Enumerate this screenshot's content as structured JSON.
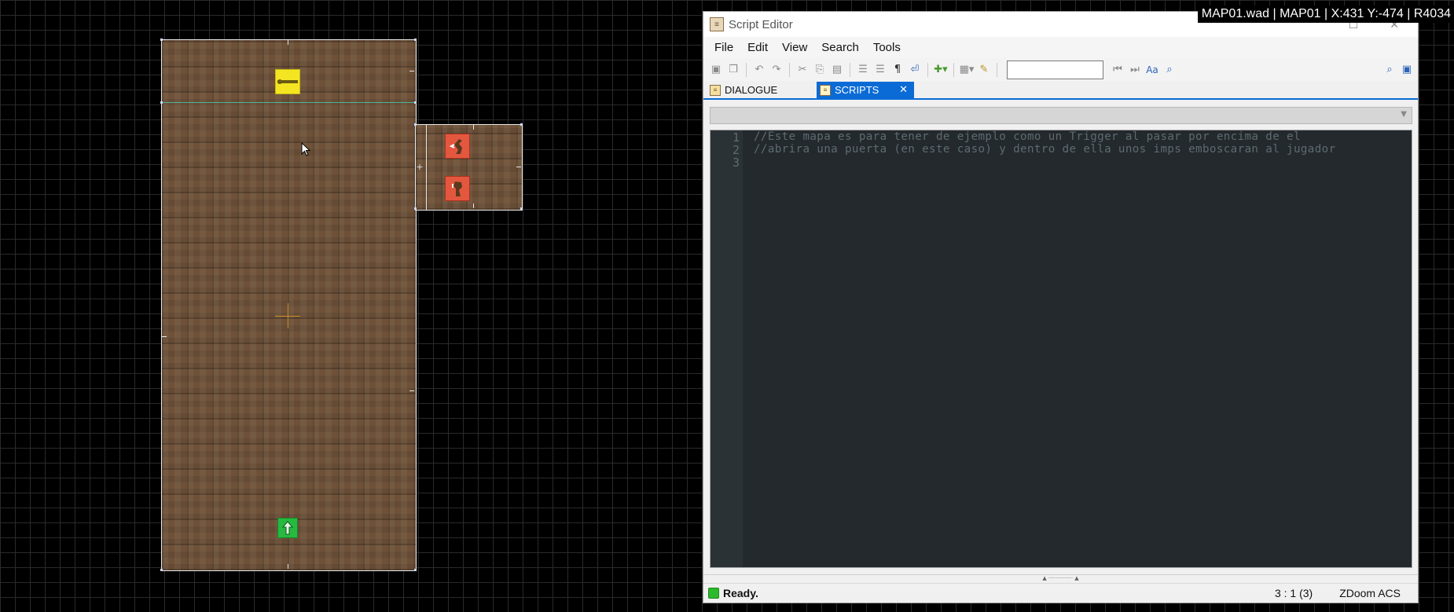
{
  "map_status": "MAP01.wad | MAP01 | X:431 Y:-474 | R4034",
  "editor": {
    "title": "Script Editor",
    "menu": [
      "File",
      "Edit",
      "View",
      "Search",
      "Tools"
    ],
    "search_value": "",
    "tabs": [
      {
        "label": "DIALOGUE",
        "active": false
      },
      {
        "label": "SCRIPTS",
        "active": true
      }
    ],
    "script_select_value": "",
    "code": {
      "line_numbers": [
        "1",
        "2",
        "3"
      ],
      "lines": [
        "//Este mapa es para tener de ejemplo como un Trigger al pasar por encima de el",
        "//abrira una puerta (en este caso) y dentro de ella unos imps emboscaran al jugador",
        ""
      ]
    },
    "status": {
      "text": "Ready.",
      "position": "3 : 1 (3)",
      "language": "ZDoom ACS"
    }
  },
  "colors": {
    "accent": "#0a6bd6",
    "code_bg": "#23292c",
    "map_grid": "#2a2a2a",
    "key_thing": "#f3e521",
    "monster_thing": "#e4573f",
    "player_thing": "#27b940"
  },
  "icons": [
    "key-icon",
    "imp-icon",
    "player-start-icon",
    "script-icon",
    "save-icon",
    "undo-icon",
    "redo-icon",
    "cut-icon",
    "copy-icon",
    "paste-icon",
    "puzzle-icon",
    "find-icon"
  ]
}
